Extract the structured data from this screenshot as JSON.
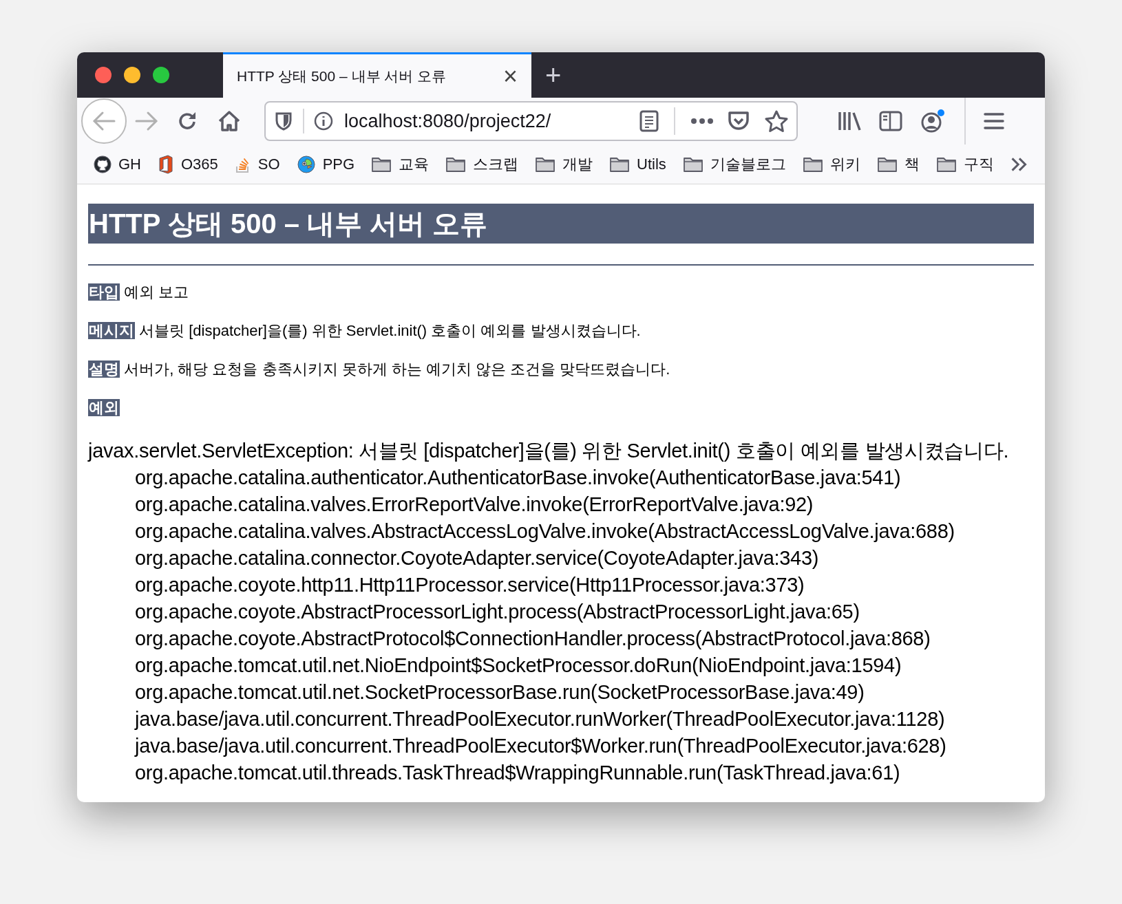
{
  "window": {
    "tabs": [
      {
        "title": "HTTP 상태 500 – 내부 서버 오류",
        "selected": true,
        "close": "×"
      }
    ],
    "new_tab": "+"
  },
  "toolbar": {
    "url": "localhost:8080/project22/"
  },
  "bookmarks": [
    {
      "kind": "github",
      "label": "GH"
    },
    {
      "kind": "office",
      "label": "O365"
    },
    {
      "kind": "stack",
      "label": "SO"
    },
    {
      "kind": "bird",
      "label": "PPG"
    },
    {
      "kind": "folder",
      "label": "교육"
    },
    {
      "kind": "folder",
      "label": "스크랩"
    },
    {
      "kind": "folder",
      "label": "개발"
    },
    {
      "kind": "folder",
      "label": "Utils"
    },
    {
      "kind": "folder",
      "label": "기술블로그"
    },
    {
      "kind": "folder",
      "label": "위키"
    },
    {
      "kind": "folder",
      "label": "책"
    },
    {
      "kind": "folder",
      "label": "구직"
    }
  ],
  "page": {
    "heading": "HTTP 상태 500 – 내부 서버 오류",
    "fields": [
      {
        "label": "타입",
        "text": "예외 보고"
      },
      {
        "label": "메시지",
        "text": "서블릿 [dispatcher]을(를) 위한 Servlet.init() 호출이 예외를 발생시켰습니다."
      },
      {
        "label": "설명",
        "text": "서버가, 해당 요청을 충족시키지 못하게 하는 예기치 않은 조건을 맞닥뜨렸습니다."
      },
      {
        "label": "예외"
      }
    ],
    "exception": "javax.servlet.ServletException: 서블릿 [dispatcher]을(를) 위한 Servlet.init() 호출이 예외를 발생시켰습니다.",
    "stack": [
      "org.apache.catalina.authenticator.AuthenticatorBase.invoke(AuthenticatorBase.java:541)",
      "org.apache.catalina.valves.ErrorReportValve.invoke(ErrorReportValve.java:92)",
      "org.apache.catalina.valves.AbstractAccessLogValve.invoke(AbstractAccessLogValve.java:688)",
      "org.apache.catalina.connector.CoyoteAdapter.service(CoyoteAdapter.java:343)",
      "org.apache.coyote.http11.Http11Processor.service(Http11Processor.java:373)",
      "org.apache.coyote.AbstractProcessorLight.process(AbstractProcessorLight.java:65)",
      "org.apache.coyote.AbstractProtocol$ConnectionHandler.process(AbstractProtocol.java:868)",
      "org.apache.tomcat.util.net.NioEndpoint$SocketProcessor.doRun(NioEndpoint.java:1594)",
      "org.apache.tomcat.util.net.SocketProcessorBase.run(SocketProcessorBase.java:49)",
      "java.base/java.util.concurrent.ThreadPoolExecutor.runWorker(ThreadPoolExecutor.java:1128)",
      "java.base/java.util.concurrent.ThreadPoolExecutor$Worker.run(ThreadPoolExecutor.java:628)",
      "org.apache.tomcat.util.threads.TaskThread$WrappingRunnable.run(TaskThread.java:61)"
    ]
  }
}
